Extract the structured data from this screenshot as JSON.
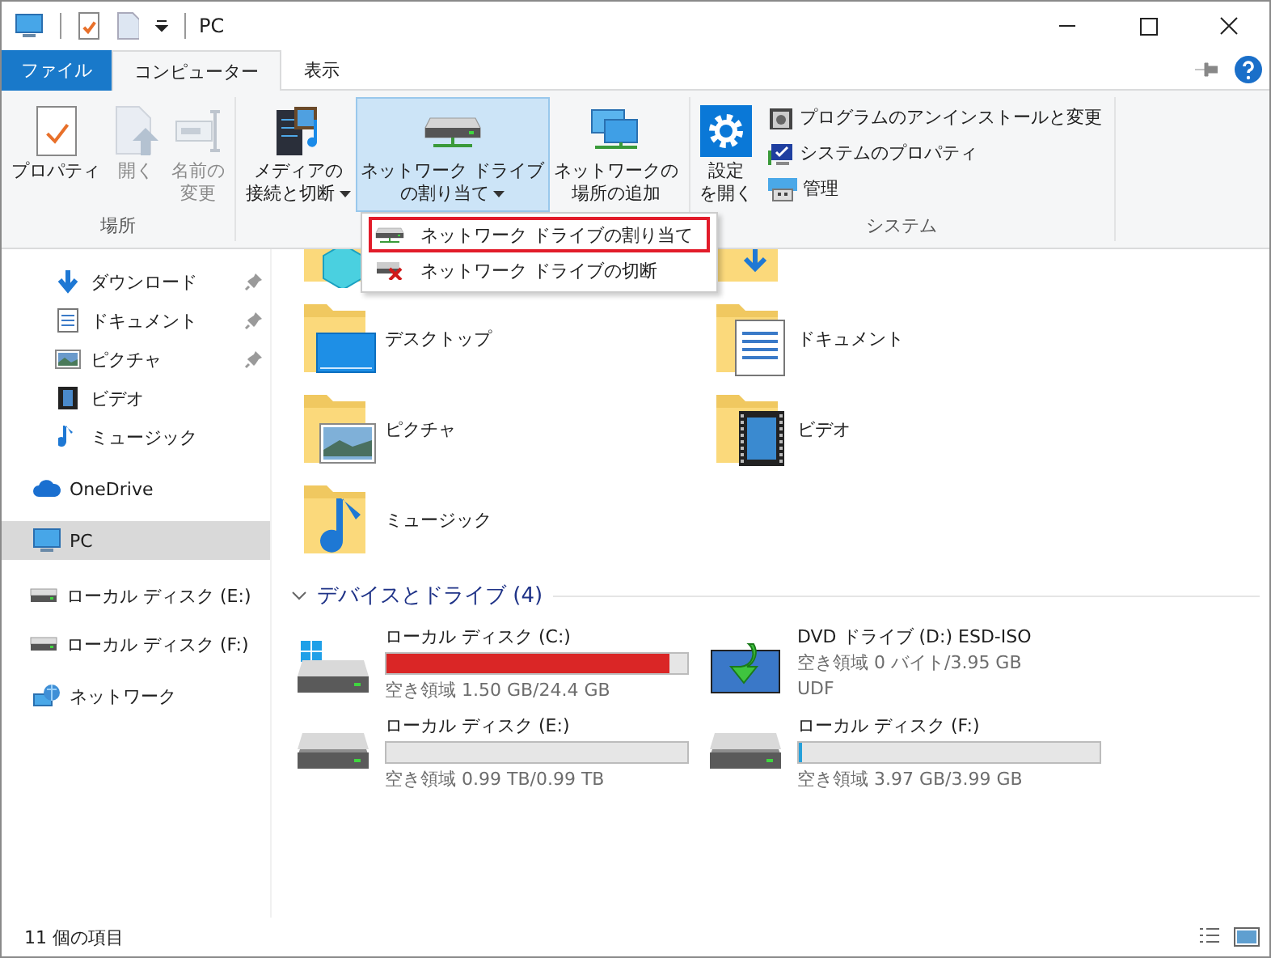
{
  "window": {
    "title": "PC"
  },
  "tabs": [
    {
      "label": "ファイル",
      "kind": "file",
      "selected": false
    },
    {
      "label": "コンピューター",
      "kind": "tab",
      "selected": true
    },
    {
      "label": "表示",
      "kind": "tab",
      "selected": false
    }
  ],
  "ribbon": {
    "groups": [
      {
        "label": "場所",
        "buttons": [
          {
            "lines": [
              "プロパティ"
            ],
            "disabled": false,
            "dropdown": false,
            "pressed": false
          },
          {
            "lines": [
              "開く"
            ],
            "disabled": true,
            "dropdown": false,
            "pressed": false
          },
          {
            "lines": [
              "名前の",
              "変更"
            ],
            "disabled": true,
            "dropdown": false,
            "pressed": false
          }
        ]
      },
      {
        "buttons": [
          {
            "lines": [
              "メディアの",
              "接続と切断"
            ],
            "disabled": false,
            "dropdown": true,
            "pressed": false
          },
          {
            "lines": [
              "ネットワーク ドライブ",
              "の割り当て"
            ],
            "disabled": false,
            "dropdown": true,
            "pressed": true
          },
          {
            "lines": [
              "ネットワークの",
              "場所の追加"
            ],
            "disabled": false,
            "dropdown": false,
            "pressed": false
          }
        ]
      },
      {
        "label": "システム",
        "buttons": [
          {
            "lines": [
              "設定",
              "を開く"
            ],
            "disabled": false,
            "dropdown": false,
            "pressed": false
          }
        ],
        "small_buttons": [
          {
            "label": "プログラムのアンインストールと変更"
          },
          {
            "label": "システムのプロパティ"
          },
          {
            "label": "管理"
          }
        ]
      }
    ]
  },
  "menu": {
    "items": [
      {
        "label": "ネットワーク ドライブの割り当て",
        "highlighted": true
      },
      {
        "label": "ネットワーク ドライブの切断",
        "highlighted": false
      }
    ]
  },
  "sidebar": {
    "items": [
      {
        "label": "ダウンロード",
        "pinned": true,
        "selected": false
      },
      {
        "label": "ドキュメント",
        "pinned": true,
        "selected": false
      },
      {
        "label": "ピクチャ",
        "pinned": true,
        "selected": false
      },
      {
        "label": "ビデオ",
        "pinned": false,
        "selected": false
      },
      {
        "label": "ミュージック",
        "pinned": false,
        "selected": false
      },
      {
        "label": "OneDrive",
        "pinned": false,
        "selected": false
      },
      {
        "label": "PC",
        "pinned": false,
        "selected": true
      },
      {
        "label": "ローカル ディスク (E:)",
        "pinned": false,
        "selected": false
      },
      {
        "label": "ローカル ディスク (F:)",
        "pinned": false,
        "selected": false
      },
      {
        "label": "ネットワーク",
        "pinned": false,
        "selected": false
      }
    ]
  },
  "folders": {
    "items": [
      {
        "label": "デスクトップ"
      },
      {
        "label": "ドキュメント"
      },
      {
        "label": "ピクチャ"
      },
      {
        "label": "ビデオ"
      },
      {
        "label": "ミュージック"
      }
    ]
  },
  "drives": {
    "header": "デバイスとドライブ (4)",
    "expanded": true,
    "items": [
      {
        "kind": "disk",
        "name": "ローカル ディスク (C:)",
        "level": 0.94,
        "color": "#da2626",
        "free": "空き領域 1.50 GB/24.4 GB"
      },
      {
        "kind": "dvd",
        "name": "DVD ドライブ (D:) ESD-ISO",
        "free": "空き領域 0 バイト/3.95 GB",
        "filesystem": "UDF"
      },
      {
        "kind": "disk",
        "name": "ローカル ディスク (E:)",
        "level": 0,
        "free": "空き領域 0.99 TB/0.99 TB"
      },
      {
        "kind": "disk",
        "name": "ローカル ディスク (F:)",
        "level": 0.01,
        "color": "#26a0da",
        "free": "空き領域 3.97 GB/3.99 GB"
      }
    ]
  },
  "status_bar": {
    "count": "11 個の項目"
  }
}
